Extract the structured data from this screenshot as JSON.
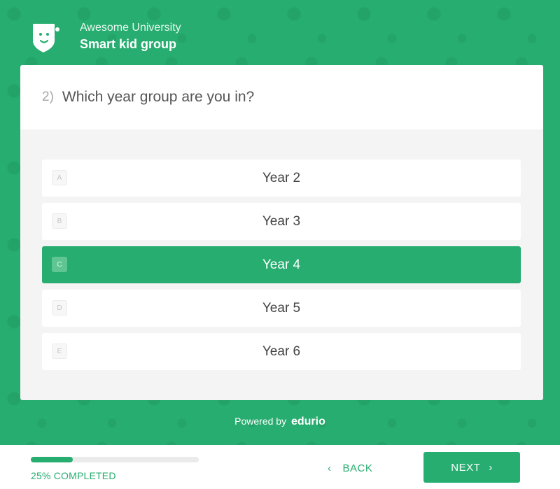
{
  "header": {
    "organization": "Awesome University",
    "group": "Smart kid group",
    "logo_icon": "smiley-shield-logo-icon"
  },
  "question": {
    "number": "2)",
    "text": "Which year group are you in?"
  },
  "options": [
    {
      "key": "A",
      "label": "Year 2",
      "selected": false
    },
    {
      "key": "B",
      "label": "Year 3",
      "selected": false
    },
    {
      "key": "C",
      "label": "Year 4",
      "selected": true
    },
    {
      "key": "D",
      "label": "Year 5",
      "selected": false
    },
    {
      "key": "E",
      "label": "Year 6",
      "selected": false
    }
  ],
  "powered": {
    "prefix": "Powered by",
    "brand": "edurio"
  },
  "footer": {
    "progress_percent": 25,
    "progress_text": "25% COMPLETED",
    "back_label": "BACK",
    "next_label": "NEXT"
  },
  "colors": {
    "accent": "#26ad6f",
    "background": "#ffffff",
    "card": "#f4f4f4"
  }
}
